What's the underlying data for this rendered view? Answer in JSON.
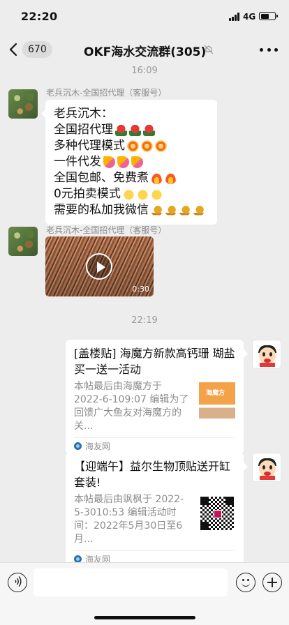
{
  "status_bar": {
    "time": "22:20",
    "network": "4G",
    "battery_level": 0.55
  },
  "header": {
    "unread_count": "670",
    "title": "OKF海水交流群(305)"
  },
  "messages": {
    "timestamp_1": "16:09",
    "msg1": {
      "sender": "老兵沉木-全国招代理（客服号）",
      "lines": [
        "老兵沉木：",
        "全国招代理",
        "多种代理模式",
        "一件代发",
        "全国包邮、免费煮",
        "0元拍卖模式",
        "需要的私加我微信"
      ]
    },
    "msg2": {
      "sender": "老兵沉木-全国招代理（客服号）",
      "video_duration": "0:30"
    },
    "timestamp_2": "22:19",
    "card1": {
      "title": "[盖楼贴] 海魔方新款高钙珊 瑚盐买一送一活动",
      "desc": "本帖最后由海魔方于 2022-6-109:07 编辑为了回馈广大鱼友对海魔方的关...",
      "source": "海友网",
      "thumb_text": "海魔方"
    },
    "card2": {
      "title": "【迎端午】益尔生物顶贴送开缸套装!",
      "desc": "本帖最后由飒枫于 2022-5-3010:53 编辑活动时间：2022年5月30日至6月...",
      "source": "海友网"
    }
  },
  "icons": [
    "back-icon",
    "mute-icon",
    "more-icon",
    "play-icon",
    "voice-icon",
    "emoji-icon",
    "plus-icon"
  ]
}
